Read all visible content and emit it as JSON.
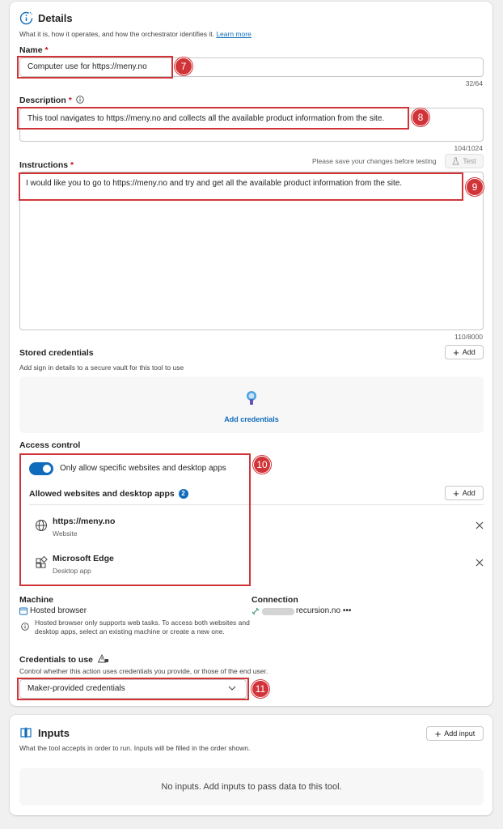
{
  "details": {
    "title": "Details",
    "subtitle": "What it is, how it operates, and how the orchestrator identifies it.",
    "learn_more": "Learn more",
    "name": {
      "label": "Name",
      "required": "*",
      "value": "Computer use for https://meny.no",
      "counter": "32/64",
      "callout": "7"
    },
    "description": {
      "label": "Description",
      "required": "*",
      "value": "This tool navigates to https://meny.no and collects all the available product information from the site.",
      "counter": "104/1024",
      "callout": "8"
    },
    "instructions": {
      "label": "Instructions",
      "required": "*",
      "value": "I would like you to go to https://meny.no and try and get all the available product information from the site.",
      "counter": "110/8000",
      "save_hint": "Please save your changes before testing",
      "test_label": "Test",
      "callout": "9"
    },
    "stored_credentials": {
      "label": "Stored credentials",
      "description": "Add sign in details to a secure vault for this tool to use",
      "add_label": "Add",
      "add_credentials_label": "Add credentials"
    },
    "access_control": {
      "label": "Access control",
      "toggle_label": "Only allow specific websites and desktop apps",
      "toggle_on": true,
      "allowed_title": "Allowed websites and desktop apps",
      "allowed_count": "2",
      "add_label": "Add",
      "callout": "10",
      "items": [
        {
          "title": "https://meny.no",
          "type": "Website",
          "icon": "globe-icon"
        },
        {
          "title": "Microsoft Edge",
          "type": "Desktop app",
          "icon": "apps-icon"
        }
      ]
    },
    "machine": {
      "label": "Machine",
      "value": "Hosted browser",
      "note": "Hosted browser only supports web tasks. To access both websites and desktop apps, select an existing machine or create a new one."
    },
    "connection": {
      "label": "Connection",
      "value": "recursion.no",
      "more": "•••"
    },
    "credentials_to_use": {
      "label": "Credentials to use",
      "description": "Control whether this action uses credentials you provide, or those of the end user.",
      "value": "Maker-provided credentials",
      "callout": "11"
    }
  },
  "inputs": {
    "title": "Inputs",
    "subtitle": "What the tool accepts in order to run. Inputs will be filled in the order shown.",
    "add_input_label": "Add input",
    "empty_text": "No inputs. Add inputs to pass data to this tool."
  },
  "colors": {
    "accent": "#0f6cbd",
    "callout": "#d13438",
    "required": "#c50f1f"
  }
}
